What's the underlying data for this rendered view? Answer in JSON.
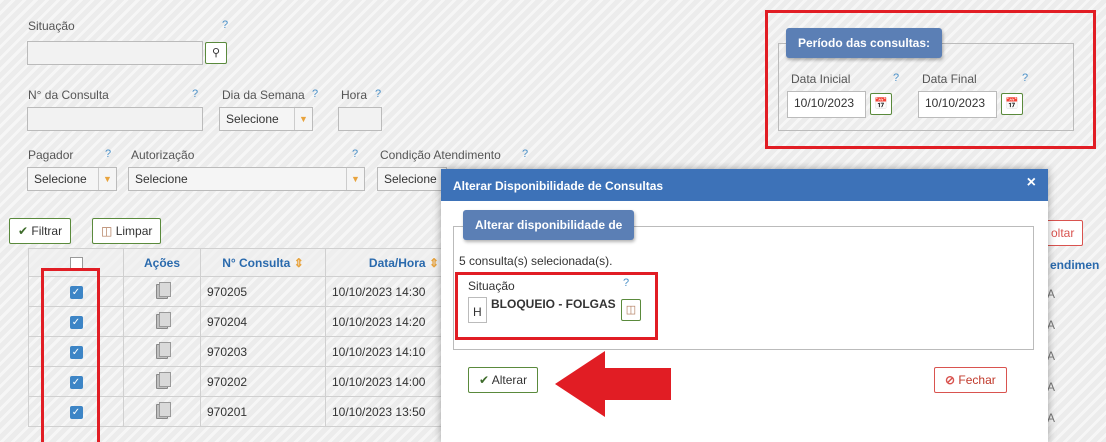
{
  "filters": {
    "situacao_label": "Situação",
    "situacao_help": "?",
    "nconsulta_label": "N° da Consulta",
    "nconsulta_help": "?",
    "dia_semana_label": "Dia da Semana",
    "dia_semana_help": "?",
    "dia_semana_value": "Selecione",
    "hora_label": "Hora",
    "hora_help": "?",
    "pagador_label": "Pagador",
    "pagador_help": "?",
    "pagador_value": "Selecione",
    "autorizacao_label": "Autorização",
    "autorizacao_help": "?",
    "autorizacao_value": "Selecione",
    "condicao_label": "Condição Atendimento",
    "condicao_help": "?",
    "condicao_value": "Selecione"
  },
  "periodo": {
    "title": "Período das consultas:",
    "data_inicial_label": "Data Inicial",
    "data_inicial_help": "?",
    "data_inicial_value": "10/10/2023",
    "data_final_label": "Data Final",
    "data_final_help": "?",
    "data_final_value": "10/10/2023"
  },
  "toolbar": {
    "filtrar_label": "Filtrar",
    "limpar_label": "Limpar",
    "voltar_label": "oltar"
  },
  "table": {
    "headers": {
      "acoes": "Ações",
      "nconsulta": "N° Consulta",
      "datahora": "Data/Hora",
      "atendimento": "endimen"
    },
    "rows": [
      {
        "numero": "970205",
        "datahora": "10/10/2023 14:30",
        "extra": "A"
      },
      {
        "numero": "970204",
        "datahora": "10/10/2023 14:20",
        "extra": "A"
      },
      {
        "numero": "970203",
        "datahora": "10/10/2023 14:10",
        "extra": "A"
      },
      {
        "numero": "970202",
        "datahora": "10/10/2023 14:00",
        "extra": "A"
      },
      {
        "numero": "970201",
        "datahora": "10/10/2023 13:50",
        "extra": "A"
      }
    ]
  },
  "dialog": {
    "title": "Alterar Disponibilidade de Consultas",
    "close_glyph": "×",
    "section_title": "Alterar disponibilidade de",
    "selected_text": "5 consulta(s) selecionada(s).",
    "situacao_label": "Situação",
    "situacao_help": "?",
    "situacao_code": "H",
    "situacao_value": "BLOQUEIO - FOLGAS",
    "alterar_label": "Alterar",
    "fechar_label": "Fechar"
  },
  "colors": {
    "accent_blue": "#3d72b8",
    "legend_blue": "#5b7fb5",
    "highlight_red": "#e11d24",
    "button_green_border": "#5a8a3c"
  }
}
